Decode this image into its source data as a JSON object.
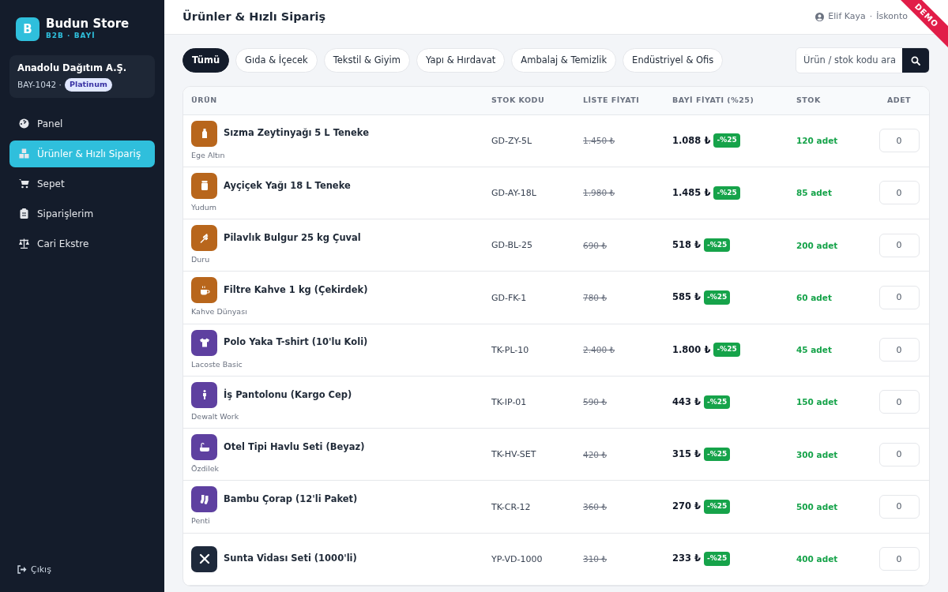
{
  "brand": {
    "logo_letter": "B",
    "name": "Budun Store",
    "subtitle": "B2B · BAYİ"
  },
  "dealer": {
    "name": "Anadolu Dağıtım A.Ş.",
    "code": "BAY-1042 ·",
    "tier": "Platinum"
  },
  "sidebar": {
    "items": [
      {
        "label": "Panel",
        "selected": false
      },
      {
        "label": "Ürünler & Hızlı Sipariş",
        "selected": true
      },
      {
        "label": "Sepet",
        "selected": false
      },
      {
        "label": "Siparişlerim",
        "selected": false
      },
      {
        "label": "Cari Ekstre",
        "selected": false
      }
    ],
    "logout": "Çıkış"
  },
  "header": {
    "title": "Ürünler & Hızlı Sipariş",
    "user": "Elif Kaya",
    "separator": "·",
    "discount": "İskonto",
    "ribbon": "DEMO"
  },
  "categories": [
    {
      "label": "Tümü",
      "selected": true
    },
    {
      "label": "Gıda & İçecek",
      "selected": false
    },
    {
      "label": "Tekstil & Giyim",
      "selected": false
    },
    {
      "label": "Yapı & Hırdavat",
      "selected": false
    },
    {
      "label": "Ambalaj & Temizlik",
      "selected": false
    },
    {
      "label": "Endüstriyel & Ofis",
      "selected": false
    }
  ],
  "search": {
    "placeholder": "Ürün / stok kodu ara"
  },
  "table": {
    "columns": [
      "ÜRÜN",
      "STOK KODU",
      "LİSTE FİYATI",
      "BAYİ FİYATI (%25)",
      "STOK",
      "ADET"
    ],
    "rows": [
      {
        "name": "Sızma Zeytinyağı 5 L Teneke",
        "brand": "Ege Altın",
        "color": "#b8661c",
        "sku": "GD-ZY-5L",
        "list_price": "1.450 ₺",
        "price": "1.088 ₺",
        "discount": "-%25",
        "stock": "120 adet",
        "qty": "0"
      },
      {
        "name": "Ayçiçek Yağı 18 L Teneke",
        "brand": "Yudum",
        "color": "#b8661c",
        "sku": "GD-AY-18L",
        "list_price": "1.980 ₺",
        "price": "1.485 ₺",
        "discount": "-%25",
        "stock": "85 adet",
        "qty": "0"
      },
      {
        "name": "Pilavlık Bulgur 25 kg Çuval",
        "brand": "Duru",
        "color": "#b8661c",
        "sku": "GD-BL-25",
        "list_price": "690 ₺",
        "price": "518 ₺",
        "discount": "-%25",
        "stock": "200 adet",
        "qty": "0"
      },
      {
        "name": "Filtre Kahve 1 kg (Çekirdek)",
        "brand": "Kahve Dünyası",
        "color": "#b8661c",
        "sku": "GD-FK-1",
        "list_price": "780 ₺",
        "price": "585 ₺",
        "discount": "-%25",
        "stock": "60 adet",
        "qty": "0"
      },
      {
        "name": "Polo Yaka T-shirt (10'lu Koli)",
        "brand": "Lacoste Basic",
        "color": "#5e40a0",
        "sku": "TK-PL-10",
        "list_price": "2.400 ₺",
        "price": "1.800 ₺",
        "discount": "-%25",
        "stock": "45 adet",
        "qty": "0"
      },
      {
        "name": "İş Pantolonu (Kargo Cep)",
        "brand": "Dewalt Work",
        "color": "#5e40a0",
        "sku": "TK-IP-01",
        "list_price": "590 ₺",
        "price": "443 ₺",
        "discount": "-%25",
        "stock": "150 adet",
        "qty": "0"
      },
      {
        "name": "Otel Tipi Havlu Seti (Beyaz)",
        "brand": "Özdilek",
        "color": "#5e40a0",
        "sku": "TK-HV-SET",
        "list_price": "420 ₺",
        "price": "315 ₺",
        "discount": "-%25",
        "stock": "300 adet",
        "qty": "0"
      },
      {
        "name": "Bambu Çorap (12'li Paket)",
        "brand": "Penti",
        "color": "#5e40a0",
        "sku": "TK-CR-12",
        "list_price": "360 ₺",
        "price": "270 ₺",
        "discount": "-%25",
        "stock": "500 adet",
        "qty": "0"
      },
      {
        "name": "Sunta Vidası Seti (1000'li)",
        "color": "#1e293b",
        "sku": "YP-VD-1000",
        "list_price": "310 ₺",
        "price": "233 ₺",
        "discount": "-%25",
        "stock": "400 adet",
        "qty": "0"
      }
    ]
  }
}
